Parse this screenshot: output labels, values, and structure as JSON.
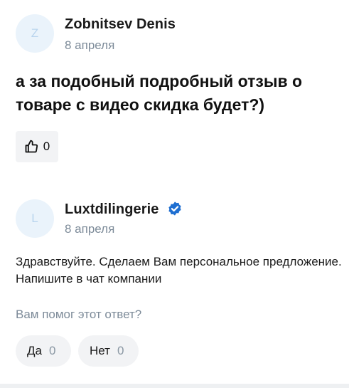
{
  "question": {
    "avatar_letter": "Z",
    "author": "Zobnitsev Denis",
    "date": "8 апреля",
    "text": "а за подобный подробный отзыв о товаре с видео скидка будет?)",
    "likes": "0",
    "like_icon": "thumbs-up-icon"
  },
  "reply": {
    "avatar_letter": "L",
    "author": "Luxtdilingerie",
    "verified_icon": "verified-check-icon",
    "date": "8 апреля",
    "text": "Здравствуйте. Сделаем Вам персональное предложение. Напишите в чат компании",
    "helpful_question": "Вам помог этот ответ?",
    "yes_label": "Да",
    "yes_count": "0",
    "no_label": "Нет",
    "no_count": "0"
  },
  "colors": {
    "accent": "#1f6fd1",
    "muted": "#7d8b99",
    "button_bg": "#f2f3f5"
  }
}
